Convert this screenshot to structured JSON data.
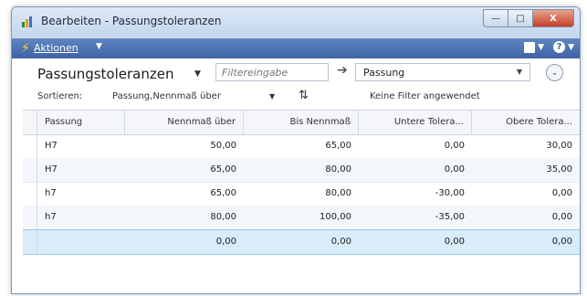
{
  "window": {
    "title": "Bearbeiten - Passungstoleranzen",
    "buttons": {
      "minimize": "—",
      "maximize": "□",
      "close": "X"
    }
  },
  "actionbar": {
    "actions_label": "Aktionen",
    "help": "?"
  },
  "list": {
    "title": "Passungstoleranzen",
    "filter_placeholder": "Filtereingabe",
    "filter_field": "Passung"
  },
  "sort": {
    "label": "Sortieren:",
    "value": "Passung,Nennmaß über",
    "filter_status": "Keine Filter angewendet"
  },
  "table": {
    "columns": [
      "Passung",
      "Nennmaß über",
      "Bis Nennmaß",
      "Untere Tolera...",
      "Obere Tolera..."
    ],
    "rows": [
      [
        "H7",
        "50,00",
        "65,00",
        "0,00",
        "30,00"
      ],
      [
        "H7",
        "65,00",
        "80,00",
        "0,00",
        "35,00"
      ],
      [
        "h7",
        "65,00",
        "80,00",
        "-30,00",
        "0,00"
      ],
      [
        "h7",
        "80,00",
        "100,00",
        "-35,00",
        "0,00"
      ],
      [
        "",
        "0,00",
        "0,00",
        "0,00",
        "0,00"
      ]
    ]
  },
  "colors": {
    "action_bar": "#4a6fb2",
    "titlebar": "#c9dbef",
    "selected_row": "#d8ecf9",
    "close_button": "#c43f25"
  }
}
